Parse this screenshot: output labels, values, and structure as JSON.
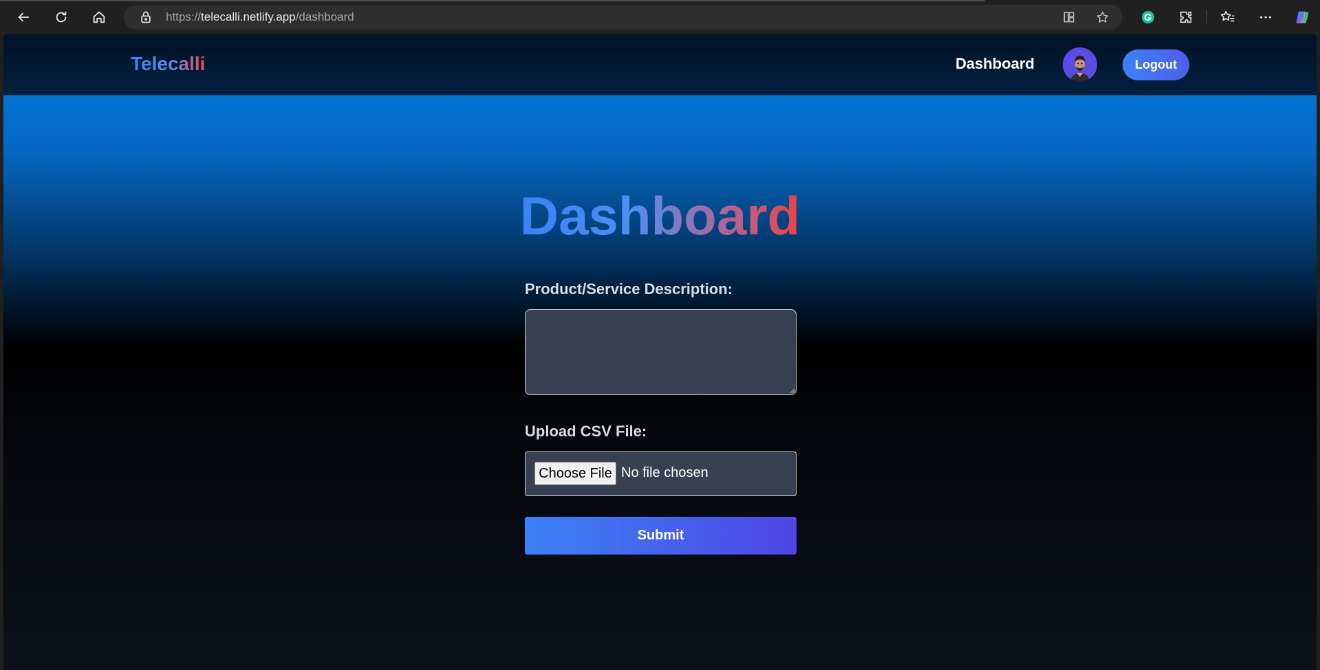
{
  "browser": {
    "url_scheme": "https://",
    "url_host": "telecalli.netlify.app",
    "url_path": "/dashboard",
    "icons": {
      "back": "back-arrow-icon",
      "refresh": "refresh-icon",
      "home": "home-icon",
      "lock": "lock-icon",
      "split_screen": "split-screen-icon",
      "favorite": "star-icon",
      "grammarly": "grammarly-icon",
      "extensions": "puzzle-icon",
      "favorites_list": "favorites-icon",
      "more": "more-icon",
      "copilot": "copilot-icon"
    }
  },
  "header": {
    "brand": "Telecalli",
    "nav_link": "Dashboard",
    "logout_label": "Logout"
  },
  "main": {
    "title": "Dashboard",
    "description_label": "Product/Service Description:",
    "description_value": "",
    "csv_label": "Upload CSV File:",
    "choose_file_label": "Choose File",
    "file_status": "No file chosen",
    "submit_label": "Submit"
  },
  "colors": {
    "accent_blue": "#3b82f6",
    "accent_indigo": "#4f46e5",
    "accent_red": "#ef4444",
    "field_bg": "#374151"
  }
}
